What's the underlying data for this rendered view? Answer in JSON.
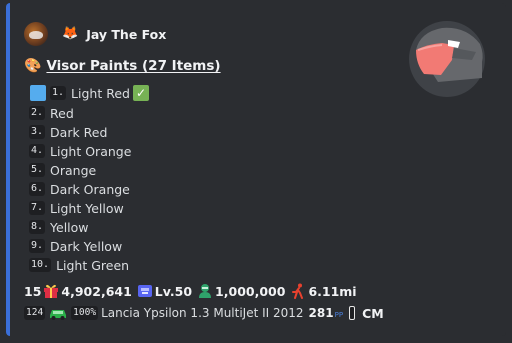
{
  "embed": {
    "accent_color": "#3a6fd9"
  },
  "author": {
    "fox_icon": "🦊",
    "name": "Jay The Fox"
  },
  "header": {
    "palette_icon": "🎨",
    "title": "Visor Paints (27 Items)"
  },
  "items": [
    {
      "num": "1.",
      "name": "Light Red",
      "selected": true
    },
    {
      "num": "2.",
      "name": "Red"
    },
    {
      "num": "3.",
      "name": "Dark Red"
    },
    {
      "num": "4.",
      "name": "Light Orange"
    },
    {
      "num": "5.",
      "name": "Orange"
    },
    {
      "num": "6.",
      "name": "Dark Orange"
    },
    {
      "num": "7.",
      "name": "Light Yellow"
    },
    {
      "num": "8.",
      "name": "Yellow"
    },
    {
      "num": "9.",
      "name": "Dark Yellow"
    },
    {
      "num": "10.",
      "name": "Light Green"
    }
  ],
  "stats": {
    "gifts": "15",
    "credits": "4,902,641",
    "level": "Lv.50",
    "xp": "1,000,000",
    "distance": "6.11mi"
  },
  "car": {
    "id": "124",
    "condition": "100%",
    "name": "Lancia Ypsilon 1.3 MultiJet II 2012",
    "pp": "281",
    "pp_label": "PP",
    "class": "CM"
  },
  "icons": {
    "helmet": "helmet-icon",
    "check": "check-mark-icon",
    "gift": "gift-icon",
    "level": "level-badge-icon",
    "xp": "driver-icon",
    "distance": "runner-icon",
    "car": "car-icon",
    "tire": "tire-icon"
  }
}
